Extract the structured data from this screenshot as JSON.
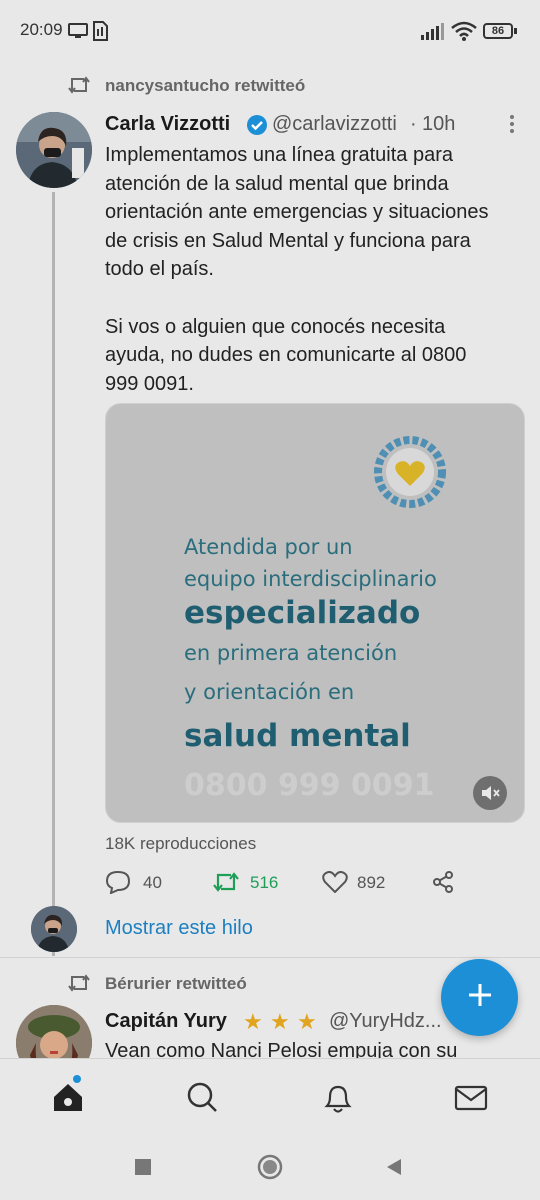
{
  "status_bar": {
    "time": "20:09",
    "battery": "86",
    "icons": [
      "monitor-icon",
      "sim-icon",
      "signal-icon",
      "wifi-icon",
      "battery-icon"
    ]
  },
  "tweet1": {
    "retweeted_by": "nancysantucho retwitteó",
    "author_name": "Carla Vizzotti",
    "author_handle": "@carlavizzotti",
    "separator": "·",
    "time": "10h",
    "text_lines": [
      "Implementamos una línea gratuita para",
      "atención de la salud mental que brinda",
      "orientación ante emergencias y situaciones",
      "de crisis en Salud Mental y funciona para",
      "todo el país.",
      "",
      "Si vos o alguien que conocés necesita",
      "ayuda, no dudes en comunicarte al 0800",
      "999 0091."
    ],
    "media": {
      "lines": [
        "Atendida por un",
        "equipo interdisciplinario",
        "especializado",
        "en primera atención",
        "y orientación en",
        "salud mental",
        "0800 999 0091"
      ]
    },
    "views": "18K reproducciones",
    "replies": "40",
    "retweets": "516",
    "likes": "892",
    "show_thread": "Mostrar este hilo"
  },
  "tweet2": {
    "retweeted_by": "Bérurier retwitteó",
    "author_name": "Capitán Yury",
    "author_handle": "@YuryHdz...",
    "text_partial": "Vean como Nanci Pelosi empuja con su"
  },
  "colors": {
    "accent": "#1d8fd6",
    "retweet_green": "#1f9e57",
    "verified": "#1d8fd6"
  }
}
